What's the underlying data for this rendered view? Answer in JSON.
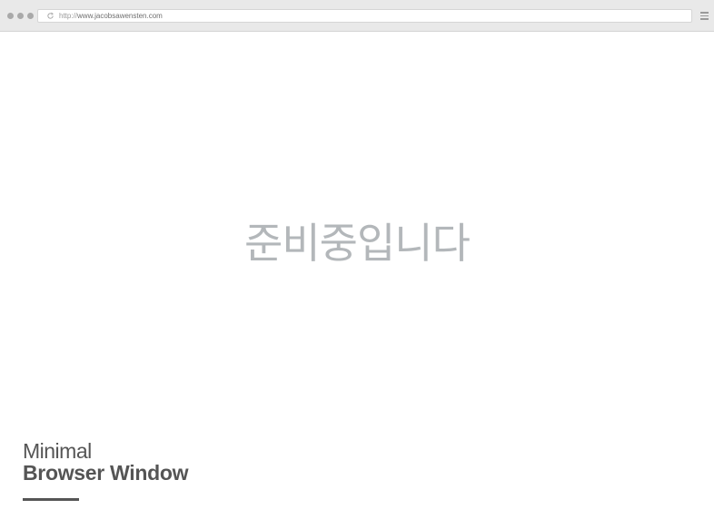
{
  "browser": {
    "url_protocol": "http://",
    "url_domain": "www.jacobsawensten.com",
    "controls": [
      "dot",
      "dot",
      "dot"
    ],
    "reload_icon": "reload-icon",
    "menu_icon": "hamburger-menu-icon"
  },
  "main": {
    "message": "준비중입니다"
  },
  "caption": {
    "line1": "Minimal",
    "line2": "Browser Window"
  },
  "colors": {
    "chrome_bg": "#e9e9e9",
    "message_text": "#b3b7ba",
    "caption_text": "#555555"
  }
}
